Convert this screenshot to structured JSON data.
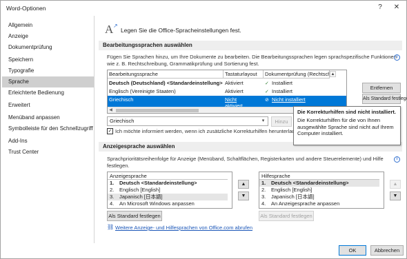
{
  "window": {
    "title": "Word-Optionen",
    "help": "?",
    "close": "✕"
  },
  "sidebar": {
    "items": [
      {
        "label": "Allgemein"
      },
      {
        "label": "Anzeige"
      },
      {
        "label": "Dokumentprüfung"
      },
      {
        "label": "Speichern"
      },
      {
        "label": "Typografie"
      },
      {
        "label": "Sprache",
        "selected": true
      },
      {
        "label": "Erleichterte Bedienung"
      },
      {
        "label": "Erweitert"
      },
      {
        "label": "Menüband anpassen"
      },
      {
        "label": "Symbolleiste für den Schnellzugriff"
      },
      {
        "label": "Add-Ins"
      },
      {
        "label": "Trust Center"
      }
    ]
  },
  "header": {
    "text": "Legen Sie die Office-Spracheinstellungen fest.",
    "icon": "language-icon"
  },
  "editing": {
    "title": "Bearbeitungssprachen auswählen",
    "description_line1": "Fügen Sie Sprachen hinzu, um Ihre Dokumente zu bearbeiten. Die Bearbeitungssprachen legen sprachspezifische Funktionen",
    "description_line2": "wie z. B. Rechtschreibung, Grammatikprüfung und Sortierung fest.",
    "columns": [
      "Bearbeitungssprache",
      "Tastaturlayout",
      "Dokumentprüfung (Rechtschreibung, ..."
    ],
    "rows": [
      {
        "language": "Deutsch (Deutschland) <Standardeinstellung>",
        "keyboard": "Aktiviert",
        "proofing": "Installiert",
        "bold": true
      },
      {
        "language": "Englisch (Vereinigte Staaten)",
        "keyboard": "Aktiviert",
        "proofing": "Installiert"
      },
      {
        "language": "Griechisch",
        "keyboard_line1": "Nicht",
        "keyboard_line2": "aktiviert",
        "proofing": "Nicht installiert",
        "selected": true
      }
    ],
    "remove_button": "Entfernen",
    "default_button": "Als Standard festlegen",
    "add_combo_value": "Griechisch",
    "add_button": "Hinzu",
    "notify_checkbox_label": "Ich möchte informiert werden, wenn ich zusätzliche Korrekturhilfen herunterlad",
    "notify_checked": true
  },
  "tooltip": {
    "title": "Die Korrekturhilfen sind nicht installiert.",
    "body_line1": "Die Korrekturhilfen für die von Ihnen",
    "body_line2": "ausgewählte Sprache sind nicht auf Ihrem",
    "body_line3": "Computer installiert."
  },
  "display": {
    "title": "Anzeigesprache auswählen",
    "description_line1": "Sprachprioritätsreihenfolge für Anzeige (Menüband, Schaltflächen, Registerkarten und andere Steuerelemente) und Hilfe",
    "description_line2": "festlegen.",
    "display_list": {
      "header": "Anzeigesprache",
      "items": [
        {
          "num": "1.",
          "label": "Deutsch <Standardeinstellung>",
          "bold": true
        },
        {
          "num": "2.",
          "label": "Englisch [English]"
        },
        {
          "num": "3.",
          "label": "Japanisch [日本語]",
          "selected": true
        },
        {
          "num": "4.",
          "label": "An Microsoft Windows anpassen"
        }
      ]
    },
    "help_list": {
      "header": "Hilfesprache",
      "items": [
        {
          "num": "1.",
          "label": "Deutsch <Standardeinstellung>",
          "bold": true,
          "selected": true
        },
        {
          "num": "2.",
          "label": "Englisch [English]"
        },
        {
          "num": "3.",
          "label": "Japanisch [日本語]"
        },
        {
          "num": "4.",
          "label": "An Anzeigesprache anpassen"
        }
      ]
    },
    "set_default_left": "Als Standard festlegen",
    "set_default_right": "Als Standard festlegen",
    "link": "Weitere Anzeige- und Hilfesprachen von Office.com abrufen"
  },
  "footer": {
    "ok": "OK",
    "cancel": "Abbrechen"
  },
  "colors": {
    "selection": "#0078d7",
    "sidebar_selected": "#cfcfcf",
    "link": "#1a56b8"
  }
}
